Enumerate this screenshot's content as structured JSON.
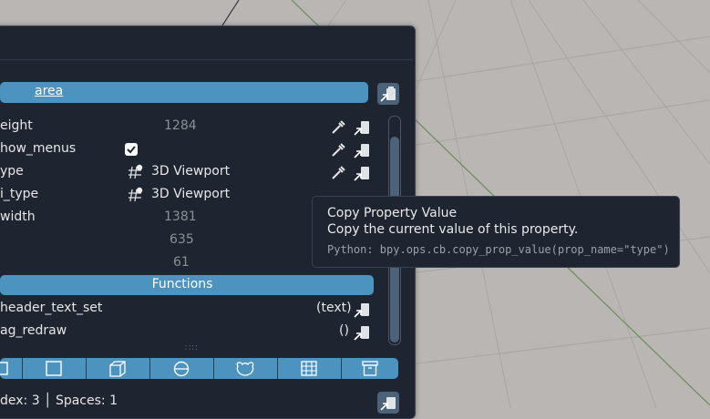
{
  "header": {
    "area_label_prefix": "area",
    "area_label_rest": ""
  },
  "properties": [
    {
      "label": "eight",
      "value": "1284",
      "kind": "number"
    },
    {
      "label": "how_menus",
      "value": "",
      "kind": "checkbox"
    },
    {
      "label": "ype",
      "value": "3D Viewport",
      "kind": "enum"
    },
    {
      "label": "i_type",
      "value": "3D Viewport",
      "kind": "enum"
    },
    {
      "label": "width",
      "value": "1381",
      "kind": "number"
    },
    {
      "label": "",
      "value": "635",
      "kind": "number"
    },
    {
      "label": "",
      "value": "61",
      "kind": "number"
    }
  ],
  "functions": {
    "label": "Functions",
    "items": [
      {
        "label": "header_text_set",
        "args": "(text)"
      },
      {
        "label": "ag_redraw",
        "args": "()"
      }
    ]
  },
  "status": {
    "text": "dex: 3 │ Spaces: 1"
  },
  "tooltip": {
    "title": "Copy Property Value",
    "description": "Copy the current value of this property.",
    "python": "Python: bpy.ops.cb.copy_prop_value(prop_name=\"type\")"
  },
  "colors": {
    "accent": "#4c93c0",
    "panel": "#1f2530",
    "viewport": "#b9b6b4"
  }
}
